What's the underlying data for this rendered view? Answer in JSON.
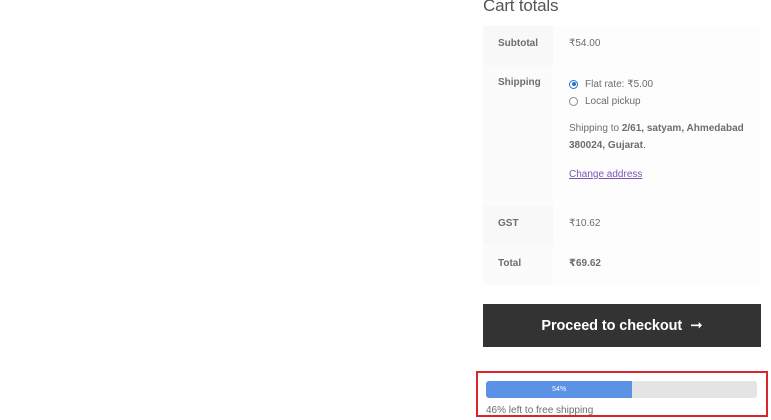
{
  "cart_totals": {
    "title": "Cart totals",
    "subtotal": {
      "label": "Subtotal",
      "value": "₹54.00"
    },
    "shipping": {
      "label": "Shipping",
      "options": [
        {
          "label": "Flat rate: ₹5.00",
          "selected": true
        },
        {
          "label": "Local pickup",
          "selected": false
        }
      ],
      "destination_prefix": "Shipping to ",
      "destination_address": "2/61, satyam, Ahmedabad 380024, Gujarat",
      "destination_suffix": ".",
      "change_address_label": "Change address"
    },
    "gst": {
      "label": "GST",
      "value": "₹10.62"
    },
    "total": {
      "label": "Total",
      "value": "₹69.62"
    }
  },
  "checkout": {
    "label": "Proceed to checkout",
    "arrow": "➞"
  },
  "free_shipping": {
    "progress_percent": 54,
    "progress_label": "54%",
    "caption": "46% left to free shipping"
  },
  "colors": {
    "accent_link": "#7f54b3",
    "button_bg": "#333333",
    "progress_fill": "#5b92e5",
    "highlight_border": "#d9262c",
    "radio_selected": "#2271d1"
  }
}
